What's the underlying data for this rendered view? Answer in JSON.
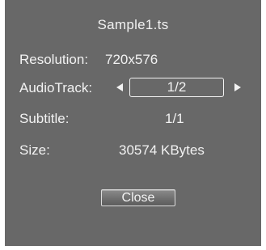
{
  "dialog": {
    "title": "Sample1.ts",
    "resolution": {
      "label": "Resolution:",
      "value": "720x576"
    },
    "audio_track": {
      "label": "AudioTrack:",
      "value": "1/2"
    },
    "subtitle": {
      "label": "Subtitle:",
      "value": "1/1"
    },
    "size": {
      "label": "Size:",
      "value": "30574 KBytes"
    },
    "close_label": "Close",
    "icons": {
      "prev": "triangle-left-icon",
      "next": "triangle-right-icon"
    },
    "colors": {
      "panel": "#686868",
      "text": "#f2f2f2",
      "page": "#ffffff"
    }
  }
}
